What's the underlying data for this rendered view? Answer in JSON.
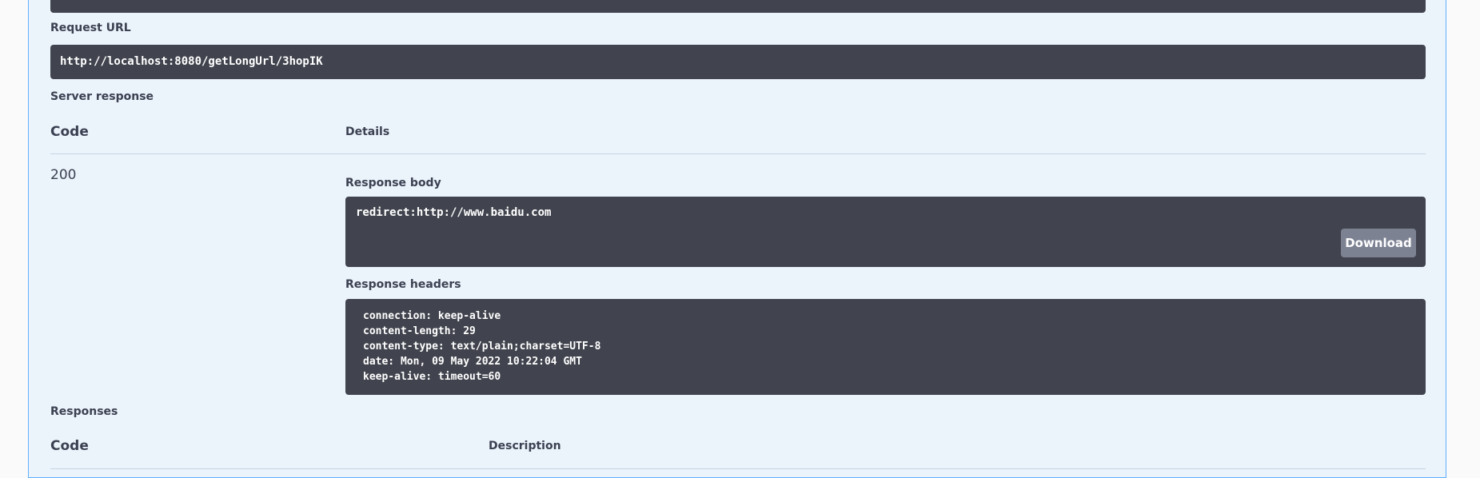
{
  "request_url": {
    "label": "Request URL",
    "value": "http://localhost:8080/getLongUrl/3hopIK"
  },
  "server_response": {
    "title": "Server response",
    "code_header": "Code",
    "details_header": "Details",
    "code": "200",
    "response_body": {
      "label": "Response body",
      "value": "redirect:http://www.baidu.com",
      "download_label": "Download"
    },
    "response_headers": {
      "label": "Response headers",
      "lines": [
        "connection: keep-alive",
        "content-length: 29",
        "content-type: text/plain;charset=UTF-8",
        "date: Mon, 09 May 2022 10:22:04 GMT",
        "keep-alive: timeout=60"
      ]
    }
  },
  "responses": {
    "title": "Responses",
    "code_header": "Code",
    "description_header": "Description"
  },
  "colors": {
    "panel_bg": "#ebf3fb",
    "panel_border": "#61affe",
    "code_bg": "#41444e",
    "button_bg": "#7d8293"
  }
}
